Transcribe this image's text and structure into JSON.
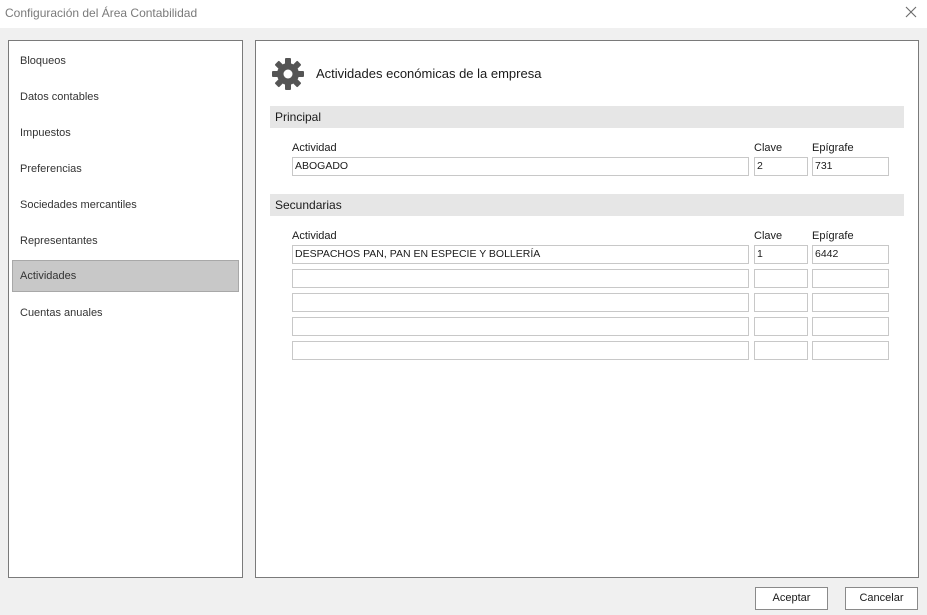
{
  "window": {
    "title": "Configuración del Área Contabilidad",
    "close_icon": "close-icon"
  },
  "sidebar": {
    "items": [
      {
        "label": "Bloqueos"
      },
      {
        "label": "Datos contables"
      },
      {
        "label": "Impuestos"
      },
      {
        "label": "Preferencias"
      },
      {
        "label": "Sociedades mercantiles"
      },
      {
        "label": "Representantes"
      },
      {
        "label": "Actividades",
        "active": true
      },
      {
        "label": "Cuentas anuales"
      }
    ]
  },
  "main": {
    "header_icon": "gear-icon",
    "title": "Actividades económicas de la empresa",
    "principal": {
      "section_label": "Principal",
      "col_actividad": "Actividad",
      "col_clave": "Clave",
      "col_epigrafe": "Epígrafe",
      "row": {
        "actividad": "ABOGADO",
        "clave": "2",
        "epigrafe": "731"
      }
    },
    "secundarias": {
      "section_label": "Secundarias",
      "col_actividad": "Actividad",
      "col_clave": "Clave",
      "col_epigrafe": "Epígrafe",
      "rows": [
        {
          "actividad": "DESPACHOS PAN, PAN EN ESPECIE Y BOLLERÍA",
          "clave": "1",
          "epigrafe": "6442"
        },
        {
          "actividad": "",
          "clave": "",
          "epigrafe": ""
        },
        {
          "actividad": "",
          "clave": "",
          "epigrafe": ""
        },
        {
          "actividad": "",
          "clave": "",
          "epigrafe": ""
        },
        {
          "actividad": "",
          "clave": "",
          "epigrafe": ""
        }
      ]
    }
  },
  "footer": {
    "accept_label": "Aceptar",
    "cancel_label": "Cancelar"
  }
}
